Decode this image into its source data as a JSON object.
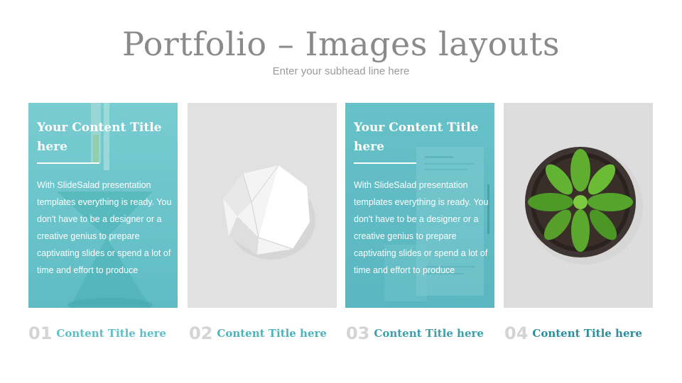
{
  "header": {
    "title": "Portfolio – Images layouts",
    "subtitle": "Enter your subhead line here"
  },
  "cards": [
    {
      "title_line1": "Your Content Title",
      "title_line2": "here",
      "body": "With SlideSalad presentation templates everything is ready. You don't have to be a designer or a creative genius to prepare captivating slides or spend a lot of time and effort to produce",
      "image": "lab-glassware-photo"
    },
    {
      "image": "white-geometric-ball-photo"
    },
    {
      "title_line1": "Your Content Title",
      "title_line2": "here",
      "body": "With SlideSalad presentation templates everything is ready. You don't have to be a designer or a creative genius to prepare captivating slides or spend a lot of time and effort to produce",
      "image": "documents-desk-photo"
    },
    {
      "image": "potted-plant-photo"
    }
  ],
  "captions": [
    {
      "number": "01",
      "label": "Content Title here",
      "color": "#5fbfc6"
    },
    {
      "number": "02",
      "label": "Content Title here",
      "color": "#4fb3bb"
    },
    {
      "number": "03",
      "label": "Content Title here",
      "color": "#3aa0ac"
    },
    {
      "number": "04",
      "label": "Content Title here",
      "color": "#2b8e9c"
    }
  ]
}
